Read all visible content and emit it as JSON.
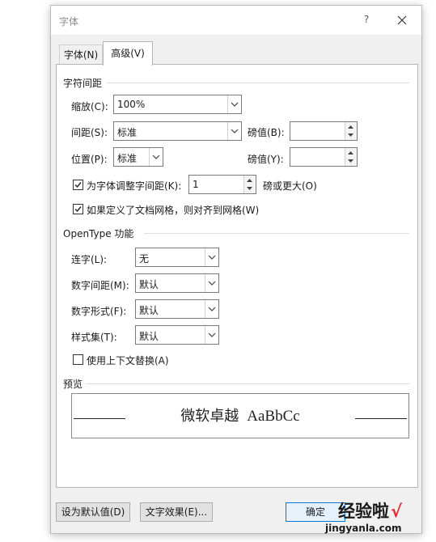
{
  "dialog": {
    "title": "字体",
    "help": "?"
  },
  "tabs": [
    {
      "label": "字体(N)",
      "active": false
    },
    {
      "label": "高级(V)",
      "active": true
    }
  ],
  "char_spacing": {
    "section_title": "字符间距",
    "scale_label": "缩放(C):",
    "scale_value": "100%",
    "spacing_label": "间距(S):",
    "spacing_value": "标准",
    "spacing_by_label": "磅值(B):",
    "spacing_by_value": "",
    "position_label": "位置(P):",
    "position_value": "标准",
    "position_by_label": "磅值(Y):",
    "position_by_value": "",
    "kerning_label": "为字体调整字间距(K):",
    "kerning_checked": true,
    "kerning_value": "1",
    "kerning_suffix": "磅或更大(O)",
    "snap_grid_label": "如果定义了文档网格，则对齐到网格(W)",
    "snap_grid_checked": true
  },
  "opentype": {
    "section_title": "OpenType 功能",
    "ligatures_label": "连字(L):",
    "ligatures_value": "无",
    "num_spacing_label": "数字间距(M):",
    "num_spacing_value": "默认",
    "num_forms_label": "数字形式(F):",
    "num_forms_value": "默认",
    "stylistic_sets_label": "样式集(T):",
    "stylistic_sets_value": "默认",
    "contextual_label": "使用上下文替换(A)",
    "contextual_checked": false
  },
  "preview": {
    "section_title": "预览",
    "sample_cjk": "微软卓越",
    "sample_latin": "AaBbCc"
  },
  "buttons": {
    "set_default": "设为默认值(D)",
    "text_effects": "文字效果(E)...",
    "ok": "确定"
  },
  "watermark": {
    "brand": "经验啦",
    "check": "√",
    "domain": "jingyanla.com"
  },
  "colors": {
    "accent": "#0078d7",
    "dialog_bg": "#f0f0f0",
    "watermark_red": "#e0282e"
  }
}
